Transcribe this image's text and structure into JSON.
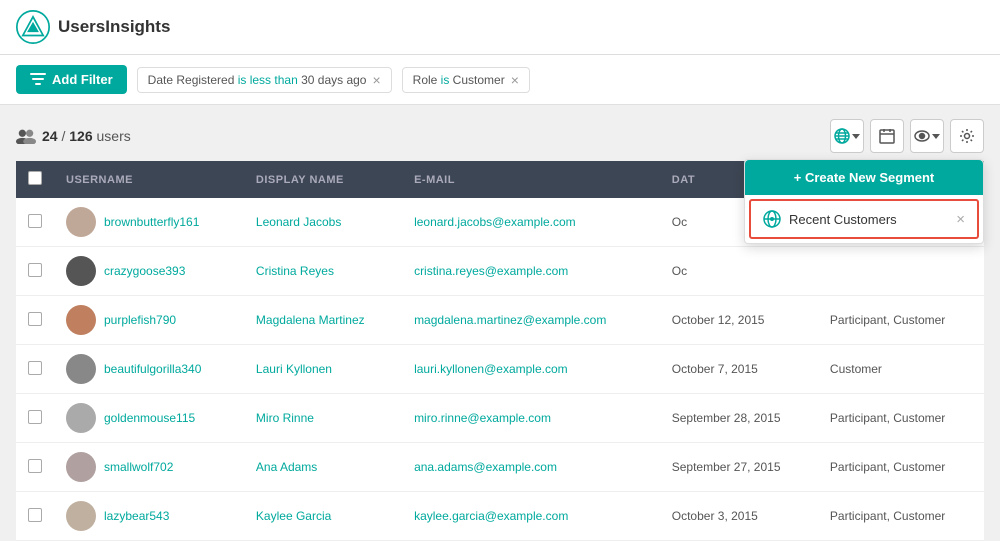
{
  "app": {
    "name": "UsersInsights"
  },
  "filter_bar": {
    "add_filter_label": "Add Filter",
    "filters": [
      {
        "label": "Date Registered",
        "operator": "is less than",
        "value": "30 days ago"
      },
      {
        "label": "Role",
        "operator": "is",
        "value": "Customer"
      }
    ]
  },
  "stats": {
    "current": "24",
    "total": "126",
    "unit": "users"
  },
  "toolbar": {
    "globe_icon": "🌐",
    "calendar_icon": "📅",
    "eye_icon": "👁",
    "settings_icon": "⚙"
  },
  "dropdown": {
    "create_segment_label": "+ Create New Segment",
    "segment_item_label": "Recent Customers"
  },
  "table": {
    "columns": [
      "",
      "Username",
      "Display Name",
      "E-Mail",
      "Date",
      ""
    ],
    "rows": [
      {
        "username": "brownbutterfly161",
        "display_name": "Leonard Jacobs",
        "email": "leonard.jacobs@example.com",
        "date": "Oc",
        "roles": "",
        "av_class": "av1"
      },
      {
        "username": "crazygoose393",
        "display_name": "Cristina Reyes",
        "email": "cristina.reyes@example.com",
        "date": "Oc",
        "roles": "",
        "av_class": "av2"
      },
      {
        "username": "purplefish790",
        "display_name": "Magdalena Martinez",
        "email": "magdalena.martinez@example.com",
        "date": "October 12, 2015",
        "roles": "Participant, Customer",
        "av_class": "av3"
      },
      {
        "username": "beautifulgorilla340",
        "display_name": "Lauri Kyllonen",
        "email": "lauri.kyllonen@example.com",
        "date": "October 7, 2015",
        "roles": "Customer",
        "av_class": "av4"
      },
      {
        "username": "goldenmouse115",
        "display_name": "Miro Rinne",
        "email": "miro.rinne@example.com",
        "date": "September 28, 2015",
        "roles": "Participant, Customer",
        "av_class": "av5"
      },
      {
        "username": "smallwolf702",
        "display_name": "Ana Adams",
        "email": "ana.adams@example.com",
        "date": "September 27, 2015",
        "roles": "Participant, Customer",
        "av_class": "av6"
      },
      {
        "username": "lazybear543",
        "display_name": "Kaylee Garcia",
        "email": "kaylee.garcia@example.com",
        "date": "October 3, 2015",
        "roles": "Participant, Customer",
        "av_class": "av7"
      }
    ]
  }
}
